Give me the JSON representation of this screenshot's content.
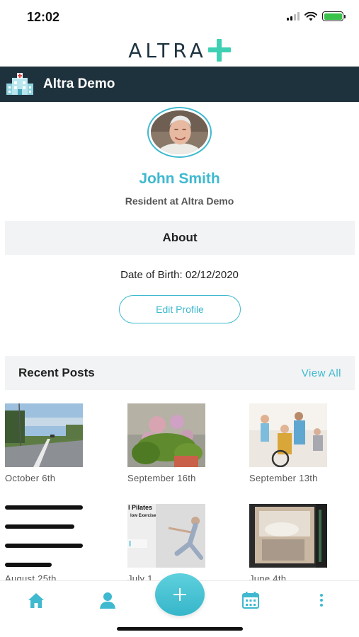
{
  "status_bar": {
    "time": "12:02"
  },
  "brand": {
    "wordmark": "ALTRA"
  },
  "header": {
    "org_name": "Altra Demo"
  },
  "profile": {
    "name": "John Smith",
    "subtitle": "Resident at Altra Demo",
    "about_title": "About",
    "date_of_birth": "Date of Birth: 02/12/2020",
    "edit_label": "Edit Profile"
  },
  "recent_posts": {
    "title": "Recent Posts",
    "view_all_label": "View All",
    "posts": [
      {
        "date": "October 6th",
        "image": "road-photo"
      },
      {
        "date": "September 16th",
        "image": "flowers-photo"
      },
      {
        "date": "September 13th",
        "image": "care-home-photo"
      },
      {
        "date": "August 25th",
        "image": "text-lines-thumbnail"
      },
      {
        "date": "July 1",
        "image": "pilates-photo",
        "overlay_text": "l Pilates",
        "overlay_sub": "low Exercise"
      },
      {
        "date": "June 4th",
        "image": "doorway-photo"
      }
    ]
  },
  "nav": {
    "items": [
      "home-icon",
      "person-icon",
      "plus-icon",
      "calendar-icon",
      "more-vertical-icon"
    ]
  },
  "colors": {
    "accent": "#3fb9cf",
    "header_bg": "#1e323d",
    "brand_plus": "#3fd0b4",
    "section_bg": "#f1f3f5"
  }
}
